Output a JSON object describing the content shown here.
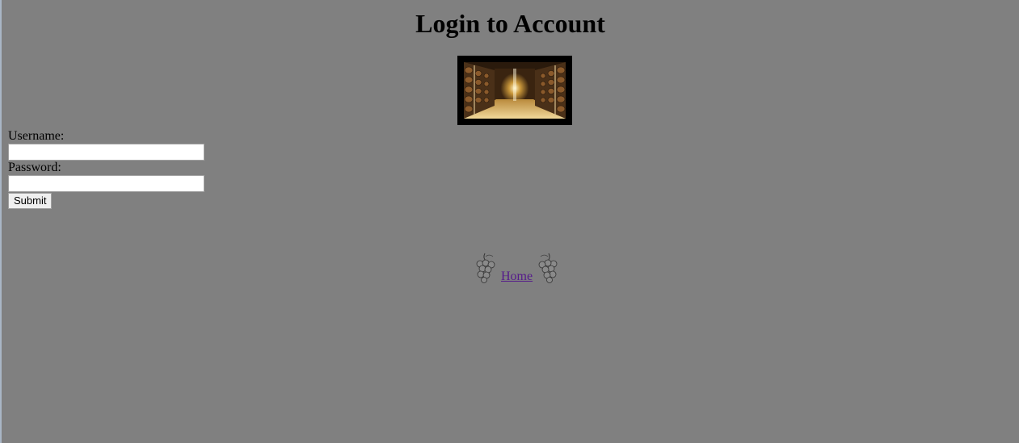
{
  "page": {
    "title": "Login to Account"
  },
  "form": {
    "username_label": "Username:",
    "username_value": "",
    "password_label": "Password:",
    "password_value": "",
    "submit_label": "Submit"
  },
  "nav": {
    "home_label": "Home",
    "icons": [
      "grape-cluster-icon",
      "grape-cluster-icon"
    ]
  },
  "colors": {
    "background": "#808080",
    "link_visited": "#551a8b",
    "banner_frame": "#000000"
  }
}
